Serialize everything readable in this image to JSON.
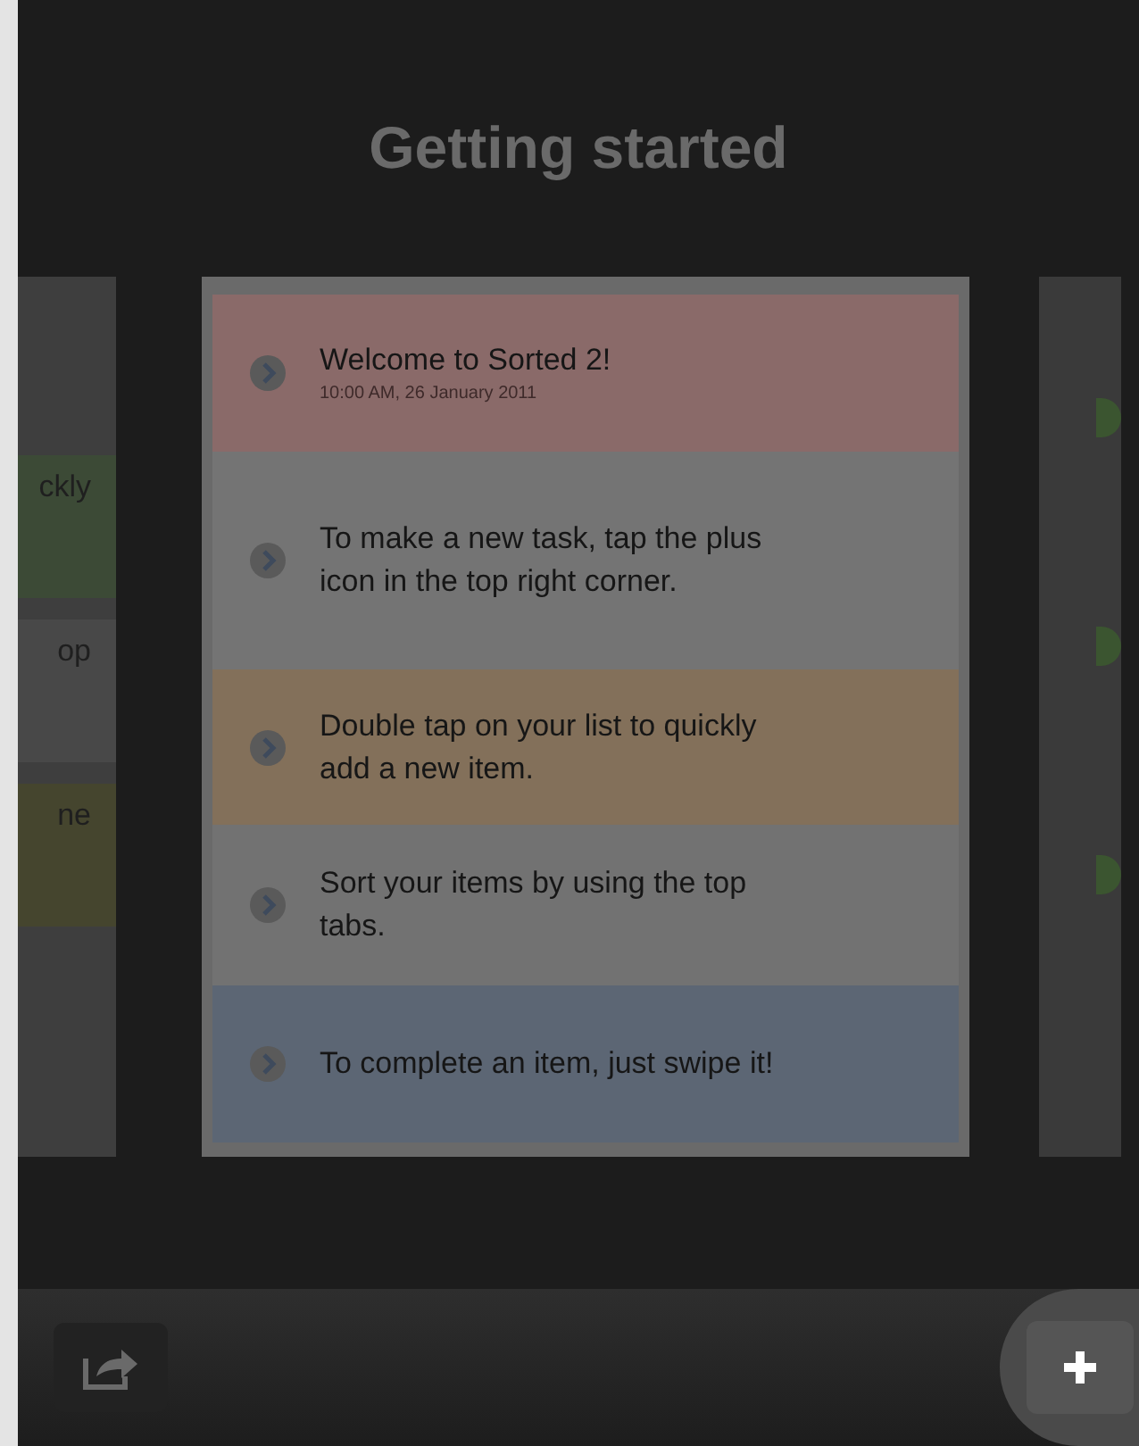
{
  "header": {
    "title": "Getting started"
  },
  "left_card": {
    "items": [
      {
        "text": "ckly",
        "color": "#3c4a36"
      },
      {
        "text": "op",
        "color": "#484848"
      },
      {
        "text": "ne",
        "color": "#45452e"
      }
    ]
  },
  "list": {
    "items": [
      {
        "text": "Welcome to Sorted 2!",
        "subtitle": "10:00 AM, 26 January 2011",
        "color": "#8a6a69"
      },
      {
        "text": "To make a new task, tap the plus icon in the top right corner.",
        "color": "#747474"
      },
      {
        "text": "Double tap on your list to quickly add a new item.",
        "color": "#83705a"
      },
      {
        "text": "Sort your items by using the top tabs.",
        "color": "#727272"
      },
      {
        "text": "To complete an item, just swipe it!",
        "color": "#5c6674"
      }
    ]
  },
  "right_card": {
    "dots": [
      {
        "color": "#3b5530"
      },
      {
        "color": "#3b5530"
      },
      {
        "color": "#3b5530"
      }
    ]
  }
}
